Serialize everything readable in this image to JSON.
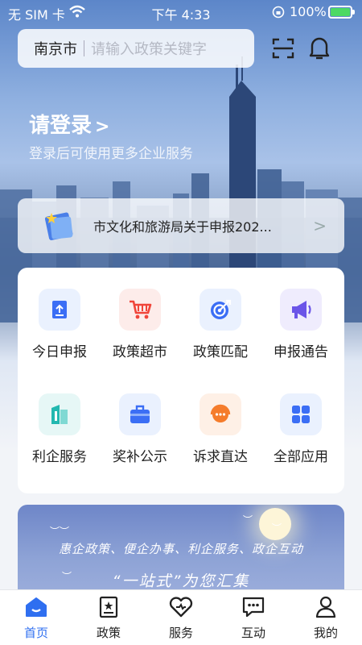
{
  "status_bar": {
    "carrier": "无 SIM 卡",
    "time": "下午 4:33",
    "battery": "100%"
  },
  "search": {
    "city": "南京市",
    "placeholder": "请输入政策关键字"
  },
  "login": {
    "title": "请登录",
    "chevron": ">",
    "subtitle": "登录后可使用更多企业服务"
  },
  "notice": {
    "text": "市文化和旅游局关于申报202...",
    "arrow": ">"
  },
  "grid": {
    "items": [
      {
        "label": "今日申报",
        "icon": "document-upload-icon",
        "color": "#3b6ef5",
        "bg": "#eaf1fe"
      },
      {
        "label": "政策超市",
        "icon": "shopping-cart-icon",
        "color": "#f0453a",
        "bg": "#fdecea"
      },
      {
        "label": "政策匹配",
        "icon": "target-icon",
        "color": "#3b6ef5",
        "bg": "#eaf1fe"
      },
      {
        "label": "申报通告",
        "icon": "megaphone-icon",
        "color": "#6b55e8",
        "bg": "#efecfd"
      },
      {
        "label": "利企服务",
        "icon": "building-icon",
        "color": "#22b8b0",
        "bg": "#e6f7f6"
      },
      {
        "label": "奖补公示",
        "icon": "briefcase-icon",
        "color": "#3b6ef5",
        "bg": "#eaf1fe"
      },
      {
        "label": "诉求直达",
        "icon": "headset-icon",
        "color": "#f57c2b",
        "bg": "#fef0e6"
      },
      {
        "label": "全部应用",
        "icon": "grid-apps-icon",
        "color": "#3b6ef5",
        "bg": "#eaf1fe"
      }
    ]
  },
  "banner": {
    "line1": "惠企政策、便企办事、利企服务、政企互动",
    "line2": "“一站式”为您汇集"
  },
  "tabbar": {
    "items": [
      {
        "label": "首页",
        "icon": "home-icon",
        "active": true
      },
      {
        "label": "政策",
        "icon": "policy-icon",
        "active": false
      },
      {
        "label": "服务",
        "icon": "heart-icon",
        "active": false
      },
      {
        "label": "互动",
        "icon": "chat-icon",
        "active": false
      },
      {
        "label": "我的",
        "icon": "user-icon",
        "active": false
      }
    ]
  },
  "colors": {
    "accent": "#2f6ff0",
    "battery": "#4cd964"
  }
}
